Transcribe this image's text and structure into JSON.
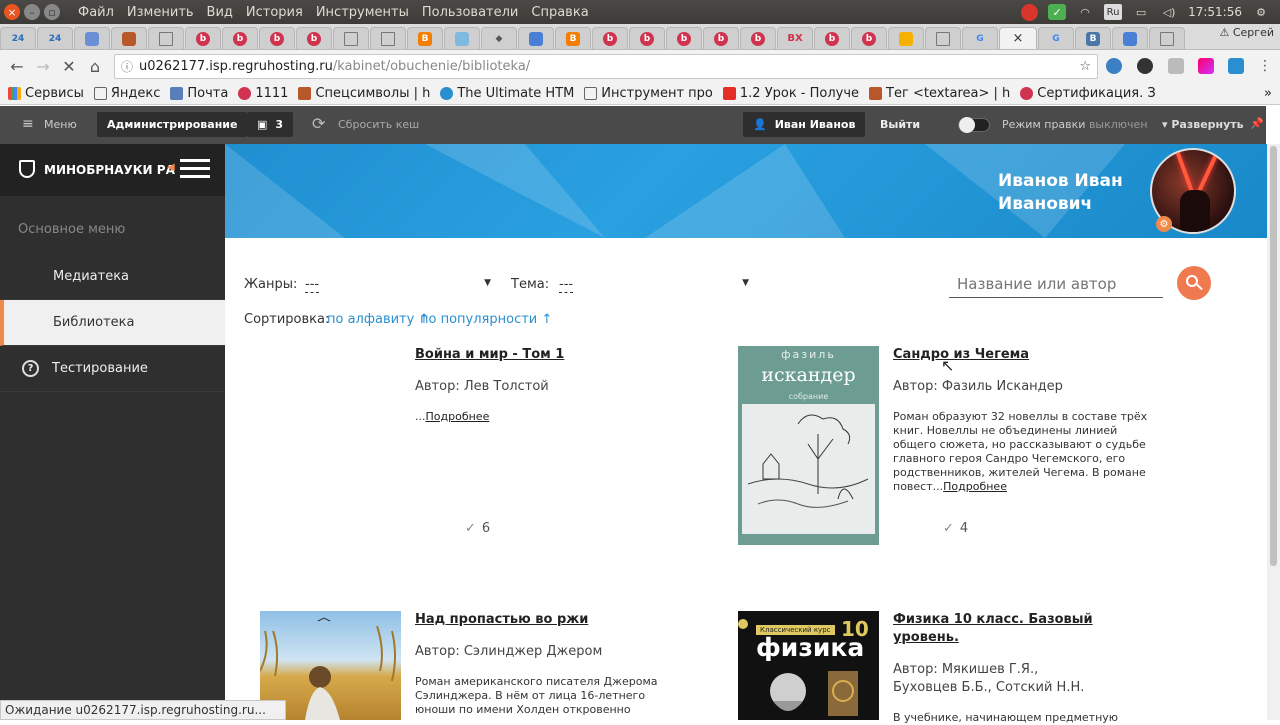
{
  "os": {
    "menu": [
      "Файл",
      "Изменить",
      "Вид",
      "История",
      "Инструменты",
      "Пользователи",
      "Справка"
    ],
    "lang": "Ru",
    "time": "17:51:56"
  },
  "tabs": {
    "first": [
      "24",
      "24"
    ],
    "profile": "Сергей"
  },
  "address": {
    "host": "u0262177.isp.regruhosting.ru",
    "path": "/kabinet/obuchenie/biblioteka/"
  },
  "bookmarks": [
    "Сервисы",
    "Яндекс",
    "Почта",
    "1111",
    "Спецсимволы | h",
    "The Ultimate HTM",
    "Инструмент про",
    "1.2 Урок - Получе",
    "Тег <textarea> | h",
    "Сертификация. З"
  ],
  "admin": {
    "menu": "Меню",
    "administration": "Администрирование",
    "count": "3",
    "reset_cache": "Сбросить кеш",
    "user": "Иван Иванов",
    "logout": "Выйти",
    "edit_mode": "Режим правки",
    "edit_state": "выключен",
    "expand": "Развернуть"
  },
  "sidebar": {
    "logo": "МИНОБРНАУКИ РА",
    "section": "Основное меню",
    "items": [
      "Медиатека",
      "Библиотека",
      "Тестирование"
    ]
  },
  "banner": {
    "user_name": "Иванов Иван Иванович"
  },
  "filters": {
    "genre_label": "Жанры:",
    "genre_value": "---",
    "theme_label": "Тема:",
    "theme_value": "---",
    "search_placeholder": "Название или автор",
    "sort_label": "Сортировка:",
    "sort_alpha": "по алфавиту ↑",
    "sort_popular": "по популярности ↑"
  },
  "books": [
    {
      "title": "Война и мир - Том 1",
      "author": "Автор: Лев Толстой",
      "desc": "...",
      "more": "Подробнее",
      "count": "6"
    },
    {
      "title": "Сандро из Чегема",
      "author": "Автор: Фазиль Искандер",
      "desc": "Роман образуют 32 новеллы в составе трёх книг. Новеллы не объединены линией общего сюжета, но рассказывают о судьбе главного героя Сандро Чегемского, его родственников, жителей Чегема. В романе повест...",
      "more": "Подробнее",
      "count": "4",
      "cover_author": "фазиль",
      "cover_surname": "искандер",
      "cover_sub": "собрание"
    },
    {
      "title": "Над пропастью во ржи",
      "author": "Автор: Сэлинджер Джером",
      "desc": "Роман американского писателя Джерома Сэлинджера. В нём от лица 16-летнего юноши по имени Холден откровенно"
    },
    {
      "title": "Физика 10 класс. Базовый уровень.",
      "author": "Автор: Мякишев Г.Я., Буховцев Б.Б., Сотский Н.Н.",
      "desc": "В учебнике, начинающем предметную линию",
      "cover_title": "физика",
      "cover_num": "10",
      "cover_series": "Классический курс"
    }
  ],
  "status": "Ожидание u0262177.isp.regruhosting.ru..."
}
